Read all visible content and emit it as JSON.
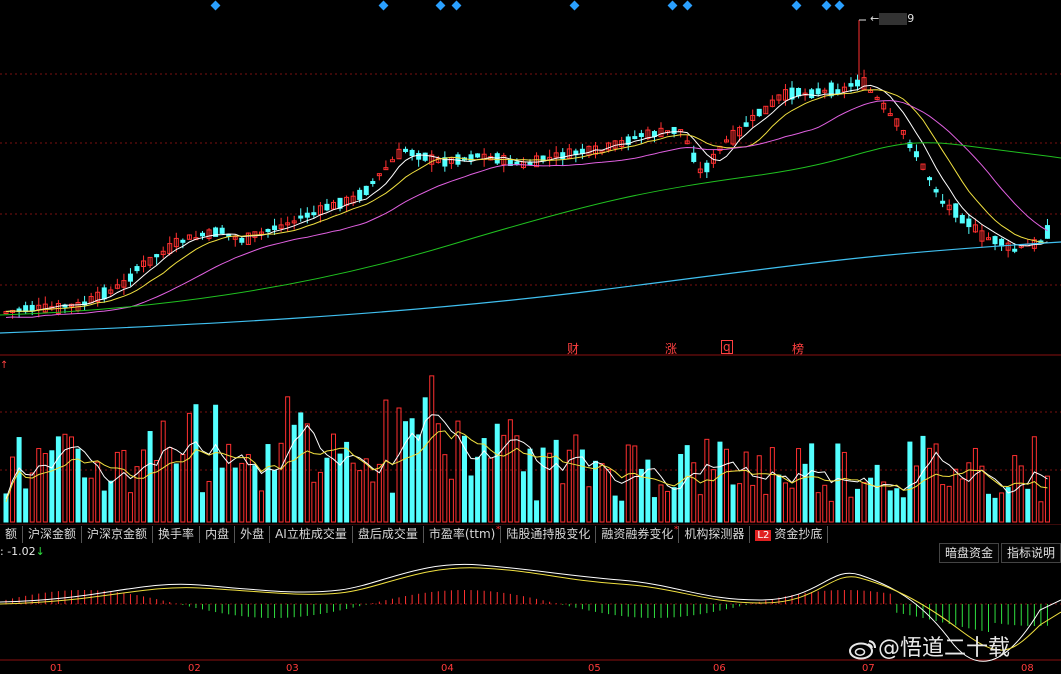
{
  "colors": {
    "up": "#ff3030",
    "down": "#54ffff",
    "ma5": "#ffffff",
    "ma10": "#f0e040",
    "ma20": "#e060e0",
    "ma60": "#20c020",
    "ma250": "#40c0f0",
    "grid": "#7a1010"
  },
  "icons": {
    "top_marker": "diamond-marker-icon",
    "weibo": "weibo-icon"
  },
  "price_chart": {
    "high_label_suffix": "9",
    "events": [
      "财",
      "涨",
      "q",
      "榜"
    ],
    "axis_marker": "↑"
  },
  "tabs": [
    {
      "label": "额",
      "star": false
    },
    {
      "label": "沪深金额",
      "star": false
    },
    {
      "label": "沪深京金额",
      "star": false
    },
    {
      "label": "换手率",
      "star": false
    },
    {
      "label": "内盘",
      "star": false
    },
    {
      "label": "外盘",
      "star": false
    },
    {
      "label": "AI立桩成交量",
      "star": false
    },
    {
      "label": "盘后成交量",
      "star": false
    },
    {
      "label": "市盈率(ttm)",
      "star": true
    },
    {
      "label": "陆股通持股变化",
      "star": false
    },
    {
      "label": "融资融券变化",
      "star": true
    },
    {
      "label": "机构探测器",
      "star": false
    },
    {
      "label": "资金抄底",
      "star": false,
      "badge": "L2"
    }
  ],
  "buttons": {
    "dark_pool": "暗盘资金",
    "indicator_help": "指标说明"
  },
  "macd": {
    "value_text": ": -1.02",
    "arrow": "↓"
  },
  "x_axis": {
    "labels": [
      "01",
      "02",
      "03",
      "04",
      "05",
      "06",
      "07",
      "08"
    ]
  },
  "watermark": {
    "text": "@悟道二十载"
  }
}
